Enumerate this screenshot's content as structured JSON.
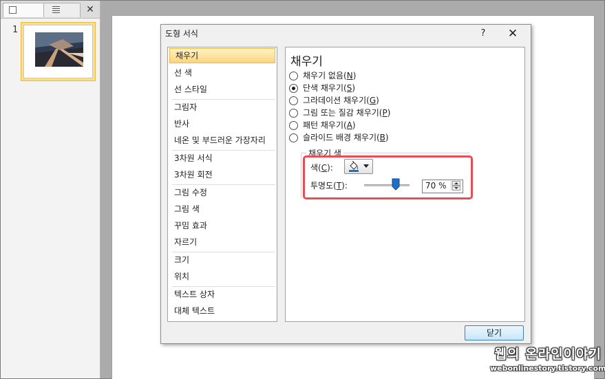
{
  "slides_pane": {
    "slide_number": "1",
    "close_glyph": "✕"
  },
  "dialog": {
    "title": "도형 서식",
    "help_glyph": "?",
    "close_glyph": "✕",
    "close_label": "닫기"
  },
  "categories": [
    "채우기",
    "선 색",
    "선 스타일",
    "그림자",
    "반사",
    "네온 및 부드러운 가장자리",
    "3차원 서식",
    "3차원 회전",
    "그림 수정",
    "그림 색",
    "꾸밈 효과",
    "자르기",
    "크기",
    "위치",
    "텍스트 상자",
    "대체 텍스트"
  ],
  "panel": {
    "heading": "채우기",
    "options": [
      {
        "text": "채우기 없음(",
        "key": "N",
        "end": ")"
      },
      {
        "text": "단색 채우기(",
        "key": "S",
        "end": ")"
      },
      {
        "text": "그라데이션 채우기(",
        "key": "G",
        "end": ")"
      },
      {
        "text": "그림 또는 질감 채우기(",
        "key": "P",
        "end": ")"
      },
      {
        "text": "패턴 채우기(",
        "key": "A",
        "end": ")"
      },
      {
        "text": "슬라이드 배경 채우기(",
        "key": "B",
        "end": ")"
      }
    ],
    "group_label": "채우기 색",
    "color": {
      "text": "색(",
      "key": "C",
      "end": "):"
    },
    "transparency": {
      "text": "투명도(",
      "key": "T",
      "end": "):",
      "value": "70 %",
      "level_percent": 70
    }
  },
  "colors": {
    "accent_highlight": "#e74d56",
    "selected_category": "#fdd47a",
    "slider_thumb": "#1f6fc6"
  },
  "icons": [
    "close-icon",
    "help-icon",
    "paint-bucket-icon",
    "chevron-down-icon",
    "spin-up-icon",
    "spin-down-icon"
  ],
  "watermark": {
    "title": "웹의 온라인이야기",
    "url": "webonlinestory.tistory.com"
  }
}
